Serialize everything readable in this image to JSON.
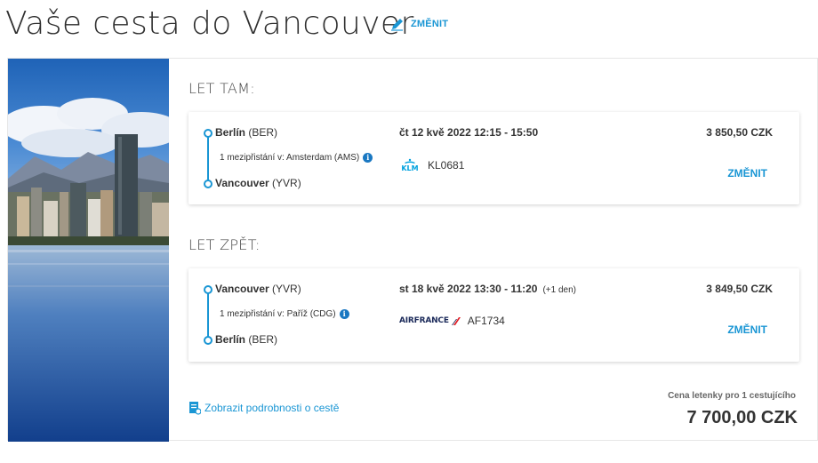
{
  "header": {
    "title": "Vaše cesta do Vancouver",
    "change_label": "ZMĚNIT"
  },
  "outbound": {
    "section_title": "LET TAM:",
    "from_city": "Berlín",
    "from_code": "(BER)",
    "stopover": "1 mezipřistání v: Amsterdam (AMS)",
    "to_city": "Vancouver",
    "to_code": "(YVR)",
    "datetime": "čt 12 kvě 2022   12:15 - 15:50",
    "airline_logo_text": "KLM",
    "flight_number": "KL0681",
    "price": "3 850,50 CZK",
    "change_label": "ZMĚNIT"
  },
  "return": {
    "section_title": "LET ZPĚT:",
    "from_city": "Vancouver",
    "from_code": "(YVR)",
    "stopover": "1 mezipřistání v: Paříž (CDG)",
    "to_city": "Berlín",
    "to_code": "(BER)",
    "datetime": "st 18 kvě 2022   13:30 - 11:20",
    "day_offset": "(+1 den)",
    "airline_logo_text": "AIRFRANCE",
    "flight_number": "AF1734",
    "price": "3 849,50 CZK",
    "change_label": "ZMĚNIT"
  },
  "footer": {
    "details_link": "Zobrazit podrobnosti o cestě",
    "total_label": "Cena letenky pro 1 cestujícího",
    "total_price": "7 700,00 CZK"
  },
  "colors": {
    "accent": "#1a96d4",
    "klm_blue": "#00a1de",
    "airfrance_red": "#e21a22"
  }
}
